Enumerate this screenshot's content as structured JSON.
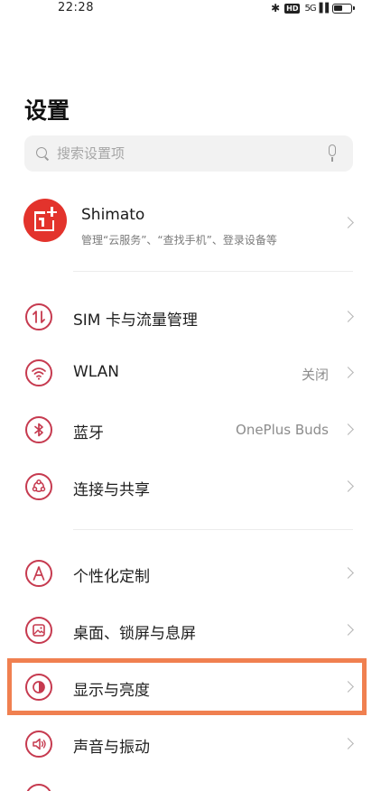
{
  "status_bar": {
    "time": "22:28",
    "bluetooth_icon": "bluetooth-icon",
    "hd_badge": "HD",
    "network": "5G",
    "battery_icon": "battery-icon"
  },
  "page": {
    "title": "设置"
  },
  "search": {
    "placeholder": "搜索设置项",
    "value": ""
  },
  "profile": {
    "name": "Shimato",
    "subtitle": "管理“云服务”、“查找手机”、登录设备等",
    "avatar_color": "#e3332c"
  },
  "accent_color": "#c63a4f",
  "highlight_color": "#f08050",
  "groups": [
    {
      "items": [
        {
          "id": "sim",
          "label": "SIM 卡与流量管理",
          "value": "",
          "icon": "data-transfer-icon"
        },
        {
          "id": "wlan",
          "label": "WLAN",
          "value": "关闭",
          "icon": "wifi-icon"
        },
        {
          "id": "bluetooth",
          "label": "蓝牙",
          "value": "OnePlus Buds",
          "icon": "bluetooth-icon"
        },
        {
          "id": "connection",
          "label": "连接与共享",
          "value": "",
          "icon": "share-connection-icon"
        }
      ]
    },
    {
      "items": [
        {
          "id": "personalize",
          "label": "个性化定制",
          "value": "",
          "icon": "personalize-icon"
        },
        {
          "id": "desktop",
          "label": "桌面、锁屏与息屏",
          "value": "",
          "icon": "wallpaper-icon"
        },
        {
          "id": "display",
          "label": "显示与亮度",
          "value": "",
          "icon": "brightness-icon",
          "highlighted": true
        },
        {
          "id": "sound",
          "label": "声音与振动",
          "value": "",
          "icon": "speaker-icon"
        }
      ]
    }
  ]
}
